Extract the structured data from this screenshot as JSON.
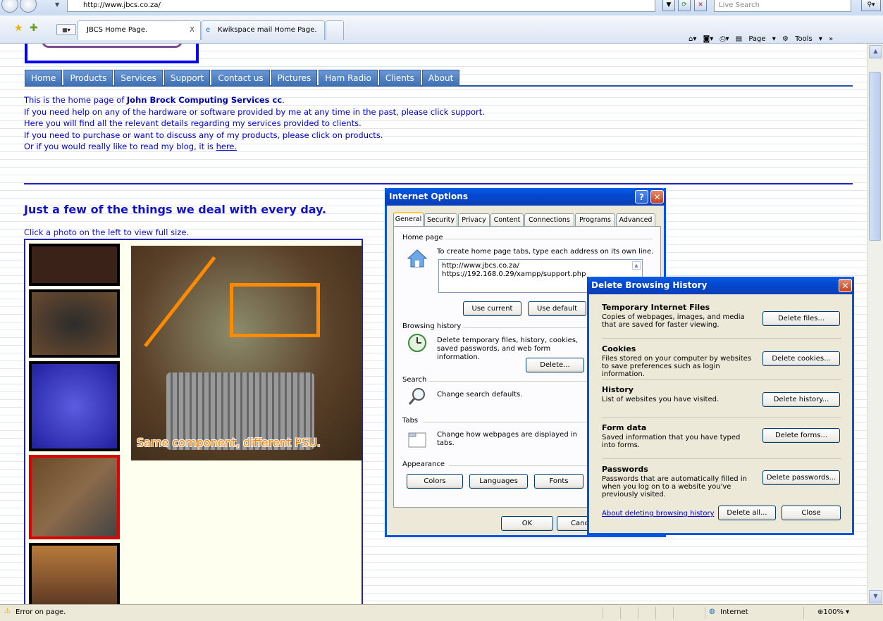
{
  "browser": {
    "url": "http://www.jbcs.co.za/",
    "search_placeholder": "Live Search",
    "tabs": [
      {
        "label": "JBCS Home Page.",
        "close": "X"
      },
      {
        "label": "Kwikspace mail Home Page."
      }
    ],
    "commands": {
      "page": "Page",
      "tools": "Tools"
    }
  },
  "site": {
    "menu": [
      "Home",
      "Products",
      "Services",
      "Support",
      "Contact us",
      "Pictures",
      "Ham Radio",
      "Clients",
      "About"
    ],
    "intro": {
      "line1_prefix": "This is the home page of ",
      "line1_bold": "John Brock Computing Services cc",
      "line1_suffix": ".",
      "line2": "If you need help on any of the hardware or software provided by me at any time in the past, please click support.",
      "line3": "Here you will find all the relevant details regarding my services provided to clients.",
      "line4": "If you need to purchase or want to discuss any of my products, please click on products.",
      "line5_prefix": "Or if you would really like to read my blog, it is ",
      "line5_link": "here."
    },
    "heading": "Just a few of the things we deal with every day.",
    "gallery_hint": "Click a photo on the left to view full size.",
    "photo_caption": "Same component, different PSU."
  },
  "internet_options": {
    "title": "Internet Options",
    "tabs": [
      "General",
      "Security",
      "Privacy",
      "Content",
      "Connections",
      "Programs",
      "Advanced"
    ],
    "home_page": {
      "group": "Home page",
      "text": "To create home page tabs, type each address on its own line.",
      "urls": [
        "http://www.jbcs.co.za/",
        "https://192.168.0.29/xampp/support.php"
      ],
      "use_current": "Use current",
      "use_default": "Use default"
    },
    "browsing_history": {
      "group": "Browsing history",
      "text": "Delete temporary files, history, cookies, saved passwords, and web form information.",
      "delete": "Delete..."
    },
    "search": {
      "group": "Search",
      "text": "Change search defaults."
    },
    "tabs_group": {
      "group": "Tabs",
      "text": "Change how webpages are displayed in tabs."
    },
    "appearance": {
      "group": "Appearance",
      "colors": "Colors",
      "languages": "Languages",
      "fonts": "Fonts"
    },
    "ok": "OK",
    "cancel": "Cancel"
  },
  "delete_history": {
    "title": "Delete Browsing History",
    "sections": [
      {
        "title": "Temporary Internet Files",
        "text": "Copies of webpages, images, and media that are saved for faster viewing.",
        "button": "Delete files..."
      },
      {
        "title": "Cookies",
        "text": "Files stored on your computer by websites to save preferences such as login information.",
        "button": "Delete cookies..."
      },
      {
        "title": "History",
        "text": "List of websites you have visited.",
        "button": "Delete history..."
      },
      {
        "title": "Form data",
        "text": "Saved information that you have typed into forms.",
        "button": "Delete forms..."
      },
      {
        "title": "Passwords",
        "text": "Passwords that are automatically filled in when you log on to a website you've previously visited.",
        "button": "Delete passwords..."
      }
    ],
    "about_link": "About deleting browsing history",
    "delete_all": "Delete all...",
    "close": "Close"
  },
  "status": {
    "message": "Error on page.",
    "zone": "Internet",
    "zoom": "100%"
  }
}
